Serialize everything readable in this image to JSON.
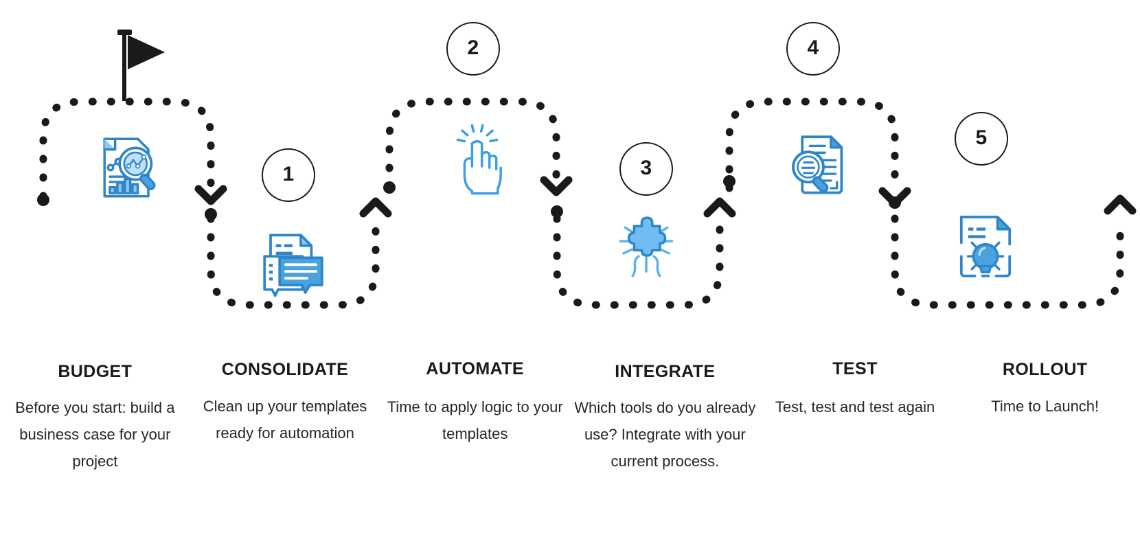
{
  "figure": {
    "type": "process-roadmap",
    "start_marker": "flag-icon",
    "colors": {
      "path": "#1a1a1a",
      "circle_outline": "#1a1a1a",
      "icon_stroke": "#2e86c8",
      "icon_fill_light": "#8fc9f2",
      "icon_fill_mid": "#4aa3e0",
      "text": "#1a1a1a",
      "background": "#ffffff"
    }
  },
  "steps": [
    {
      "number": "",
      "title": "BUDGET",
      "description": "Before you start: build a business case for your project",
      "icon": "document-chart-magnifier-icon"
    },
    {
      "number": "1",
      "title": "CONSOLIDATE",
      "description": "Clean up your templates ready for automation",
      "icon": "documents-chat-icon"
    },
    {
      "number": "2",
      "title": "AUTOMATE",
      "description": "Time to apply logic to your templates",
      "icon": "click-hand-icon"
    },
    {
      "number": "3",
      "title": "INTEGRATE",
      "description": "Which tools do you already use? Integrate with your current process.",
      "icon": "hand-puzzle-piece-icon"
    },
    {
      "number": "4",
      "title": "TEST",
      "description": "Test, test and test again",
      "icon": "document-magnifier-icon"
    },
    {
      "number": "5",
      "title": "ROLLOUT",
      "description": "Time to Launch!",
      "icon": "document-lightbulb-icon"
    }
  ]
}
